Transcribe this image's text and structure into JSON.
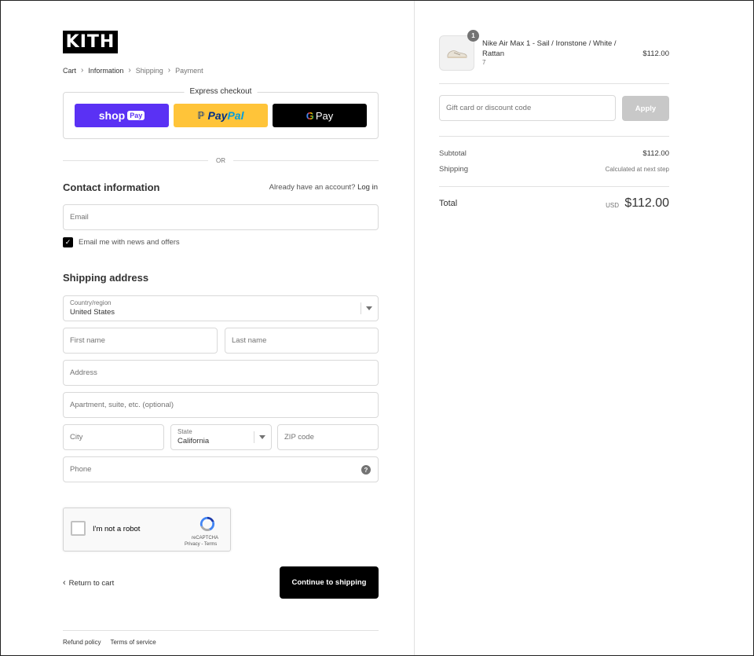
{
  "brand": {
    "logo_text": "KITH"
  },
  "breadcrumb": [
    {
      "label": "Cart",
      "muted": false
    },
    {
      "label": "Information",
      "muted": false
    },
    {
      "label": "Shipping",
      "muted": true
    },
    {
      "label": "Payment",
      "muted": true
    }
  ],
  "express": {
    "title": "Express checkout",
    "shop_pay": {
      "label": "shop",
      "pill": "Pay"
    },
    "paypal": {
      "part1": "Pay",
      "part2": "Pal"
    },
    "gpay": {
      "g": "G",
      "label": "Pay"
    },
    "or_label": "OR"
  },
  "contact": {
    "title": "Contact information",
    "account_prompt": "Already have an account?",
    "login_label": "Log in",
    "email_placeholder": "Email",
    "newsletter_label": "Email me with news and offers",
    "newsletter_checked": true
  },
  "shipping": {
    "title": "Shipping address",
    "country_label": "Country/region",
    "country_value": "United States",
    "first_name_placeholder": "First name",
    "last_name_placeholder": "Last name",
    "address_placeholder": "Address",
    "apartment_placeholder": "Apartment, suite, etc. (optional)",
    "city_placeholder": "City",
    "state_label": "State",
    "state_value": "California",
    "zip_placeholder": "ZIP code",
    "phone_placeholder": "Phone",
    "help_glyph": "?"
  },
  "recaptcha": {
    "label": "I'm not a robot",
    "brand": "reCAPTCHA",
    "privacy": "Privacy",
    "link_sep": " - ",
    "terms": "Terms"
  },
  "actions": {
    "return_label": "Return to cart",
    "continue_label": "Continue to shipping"
  },
  "footer": {
    "refund_policy": "Refund policy",
    "terms_of_service": "Terms of service"
  },
  "summary": {
    "item": {
      "quantity": "1",
      "name": "Nike Air Max 1 - Sail / Ironstone / White / Rattan",
      "variant": "7",
      "price": "$112.00"
    },
    "discount_placeholder": "Gift card or discount code",
    "apply_label": "Apply",
    "subtotal_label": "Subtotal",
    "subtotal_value": "$112.00",
    "shipping_label": "Shipping",
    "shipping_value": "Calculated at next step",
    "total_label": "Total",
    "total_currency": "USD",
    "total_value": "$112.00"
  },
  "colors": {
    "shop_pay": "#5a31f4",
    "paypal": "#ffc439",
    "primary_button": "#000000",
    "apply_disabled": "#c8c8c8"
  }
}
